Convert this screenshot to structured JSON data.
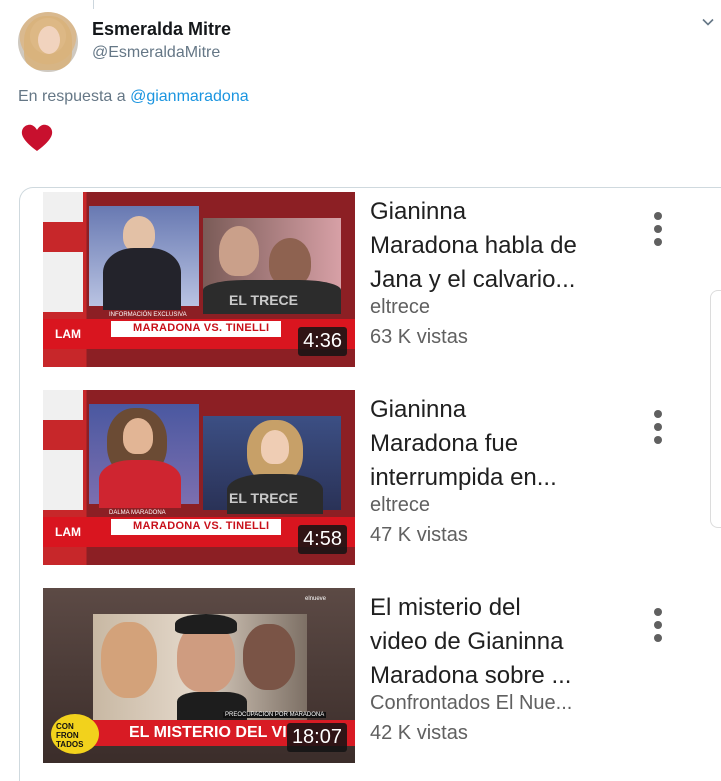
{
  "tweet": {
    "user_name": "Esmeralda Mitre",
    "user_handle": "@EsmeraldaMitre",
    "reply_prefix": "En respuesta a",
    "reply_mention": "@gianmaradona"
  },
  "icons": {
    "heart": "heart-icon",
    "more": "more-vertical-icon",
    "chevron": "chevron-down-icon"
  },
  "colors": {
    "heart": "#c8102e",
    "mention": "#1b95e0",
    "duration_bg": "#141414",
    "lam_red": "#d9151f"
  },
  "videos": [
    {
      "title_line1": "Gianinna",
      "title_line2": "Maradona habla de",
      "title_line3": "Jana y el calvario...",
      "channel": "eltrece",
      "views": "63 K vistas",
      "duration": "4:36",
      "thumb": {
        "lam": "LAM",
        "band": "MARADONA VS. TINELLI",
        "caption": "INFORMACIÓN EXCLUSIVA",
        "watermark": "EL TRECE"
      }
    },
    {
      "title_line1": "Gianinna",
      "title_line2": "Maradona fue",
      "title_line3": "interrumpida en...",
      "channel": "eltrece",
      "views": "47 K vistas",
      "duration": "4:58",
      "thumb": {
        "lam": "LAM",
        "band": "MARADONA VS. TINELLI",
        "caption": "DALMA MARADONA",
        "watermark": "EL TRECE"
      }
    },
    {
      "title_line1": "El misterio del",
      "title_line2": "video de Gianinna",
      "title_line3": "Maradona sobre ...",
      "channel": "Confrontados El Nue...",
      "views": "42 K vistas",
      "duration": "18:07",
      "thumb": {
        "bar_text": "EL MISTERIO DEL VI",
        "logo_line1": "CON",
        "logo_line2": "FRON",
        "logo_line3": "TADOS",
        "strap": "PREOCUPACION POR MARADONA",
        "badge": "elnueve"
      }
    }
  ]
}
